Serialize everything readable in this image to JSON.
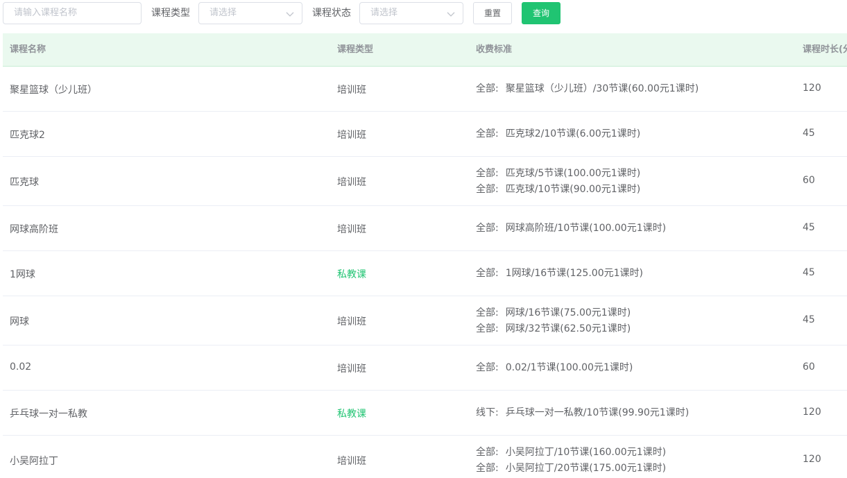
{
  "filters": {
    "name_placeholder": "请输入课程名称",
    "type_label": "课程类型",
    "type_placeholder": "请选择",
    "status_label": "课程状态",
    "status_placeholder": "请选择",
    "reset_label": "重置",
    "query_label": "查询"
  },
  "table": {
    "headers": [
      "课程名称",
      "课程类型",
      "收费标准",
      "课程时长(分"
    ],
    "rows": [
      {
        "name": "聚星篮球（少儿班）",
        "type": "培训班",
        "private": false,
        "prices": [
          {
            "scope": "全部:",
            "text": "聚星篮球（少儿班）/30节课(60.00元1课时)"
          }
        ],
        "duration": "120"
      },
      {
        "name": "匹克球2",
        "type": "培训班",
        "private": false,
        "prices": [
          {
            "scope": "全部:",
            "text": "匹克球2/10节课(6.00元1课时)"
          }
        ],
        "duration": "45"
      },
      {
        "name": "匹克球",
        "type": "培训班",
        "private": false,
        "prices": [
          {
            "scope": "全部:",
            "text": "匹克球/5节课(100.00元1课时)"
          },
          {
            "scope": "全部:",
            "text": "匹克球/10节课(90.00元1课时)"
          }
        ],
        "duration": "60"
      },
      {
        "name": "网球高阶班",
        "type": "培训班",
        "private": false,
        "prices": [
          {
            "scope": "全部:",
            "text": "网球高阶班/10节课(100.00元1课时)"
          }
        ],
        "duration": "45"
      },
      {
        "name": "1网球",
        "type": "私教课",
        "private": true,
        "prices": [
          {
            "scope": "全部:",
            "text": "1网球/16节课(125.00元1课时)"
          }
        ],
        "duration": "45"
      },
      {
        "name": "网球",
        "type": "培训班",
        "private": false,
        "prices": [
          {
            "scope": "全部:",
            "text": "网球/16节课(75.00元1课时)"
          },
          {
            "scope": "全部:",
            "text": "网球/32节课(62.50元1课时)"
          }
        ],
        "duration": "45"
      },
      {
        "name": "0.02",
        "type": "培训班",
        "private": false,
        "prices": [
          {
            "scope": "全部:",
            "text": "0.02/1节课(100.00元1课时)"
          }
        ],
        "duration": "60"
      },
      {
        "name": "乒乓球一对一私教",
        "type": "私教课",
        "private": true,
        "prices": [
          {
            "scope": "线下:",
            "text": "乒乓球一对一私教/10节课(99.90元1课时)"
          }
        ],
        "duration": "120"
      },
      {
        "name": "小吴阿拉丁",
        "type": "培训班",
        "private": false,
        "prices": [
          {
            "scope": "全部:",
            "text": "小吴阿拉丁/10节课(160.00元1课时)"
          },
          {
            "scope": "全部:",
            "text": "小吴阿拉丁/20节课(175.00元1课时)"
          }
        ],
        "duration": "120"
      }
    ]
  },
  "icons": {
    "select_arrow": "chevron-down-icon"
  },
  "colors": {
    "accent": "#20c472",
    "header_bg": "#eaf9ef"
  }
}
